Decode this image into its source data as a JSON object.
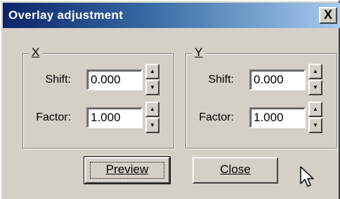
{
  "window": {
    "title": "Overlay adjustment",
    "close_glyph": "X"
  },
  "groups": {
    "x": {
      "legend": "X",
      "shift_label": "Shift:",
      "shift_value": "0.000",
      "factor_label": "Factor:",
      "factor_value": "1.000"
    },
    "y": {
      "legend": "Y",
      "shift_label": "Shift:",
      "shift_value": "0.000",
      "factor_label": "Factor:",
      "factor_value": "1.000"
    }
  },
  "buttons": {
    "preview_label": "Preview",
    "close_label": "Close"
  },
  "icons": {
    "spin_up": "up-arrow-icon",
    "spin_down": "down-arrow-icon",
    "cursor": "mouse-pointer-icon"
  },
  "colors": {
    "face": "#d4d0c8",
    "title_start": "#0a246a",
    "title_end": "#a6caf0"
  }
}
